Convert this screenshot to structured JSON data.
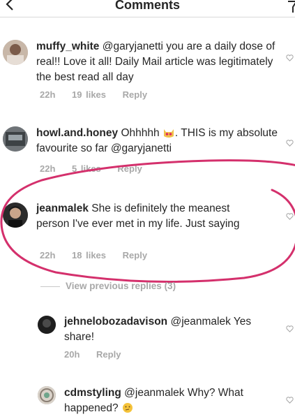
{
  "header": {
    "title": "Comments"
  },
  "comments": [
    {
      "username": "muffy_white",
      "text": "@garyjanetti you are a daily dose of real!! Love it all! Daily Mail article was legitimately the best read all day",
      "time": "22h",
      "likes": "19 likes",
      "reply": "Reply"
    },
    {
      "username": "howl.and.honey",
      "text_before_emoji": "Ohhhhh",
      "text_after_emoji": ". THIS is my absolute favourite so far @garyjanetti",
      "emoji_icon": "cat-heart-eyes-emoji-icon",
      "time": "22h",
      "likes": "5 likes",
      "reply": "Reply"
    },
    {
      "username": "jeanmalek",
      "text": "She is definitely the meanest person I've ever met in my life. Just saying",
      "time": "22h",
      "likes": "18 likes",
      "reply": "Reply"
    }
  ],
  "view_previous": "View previous replies (3)",
  "replies": [
    {
      "username": "jehnelobozadavison",
      "text": "@jeanmalek Yes share!",
      "time": "20h",
      "reply": "Reply"
    },
    {
      "username": "cdmstyling",
      "text": "@jeanmalek Why? What happened?",
      "emoji_icon": "thinking-face-emoji-icon",
      "time": "",
      "reply": ""
    }
  ],
  "colors": {
    "annotation": "#d4306c",
    "meta_text": "#a8a8a8",
    "body_text": "#262626"
  }
}
